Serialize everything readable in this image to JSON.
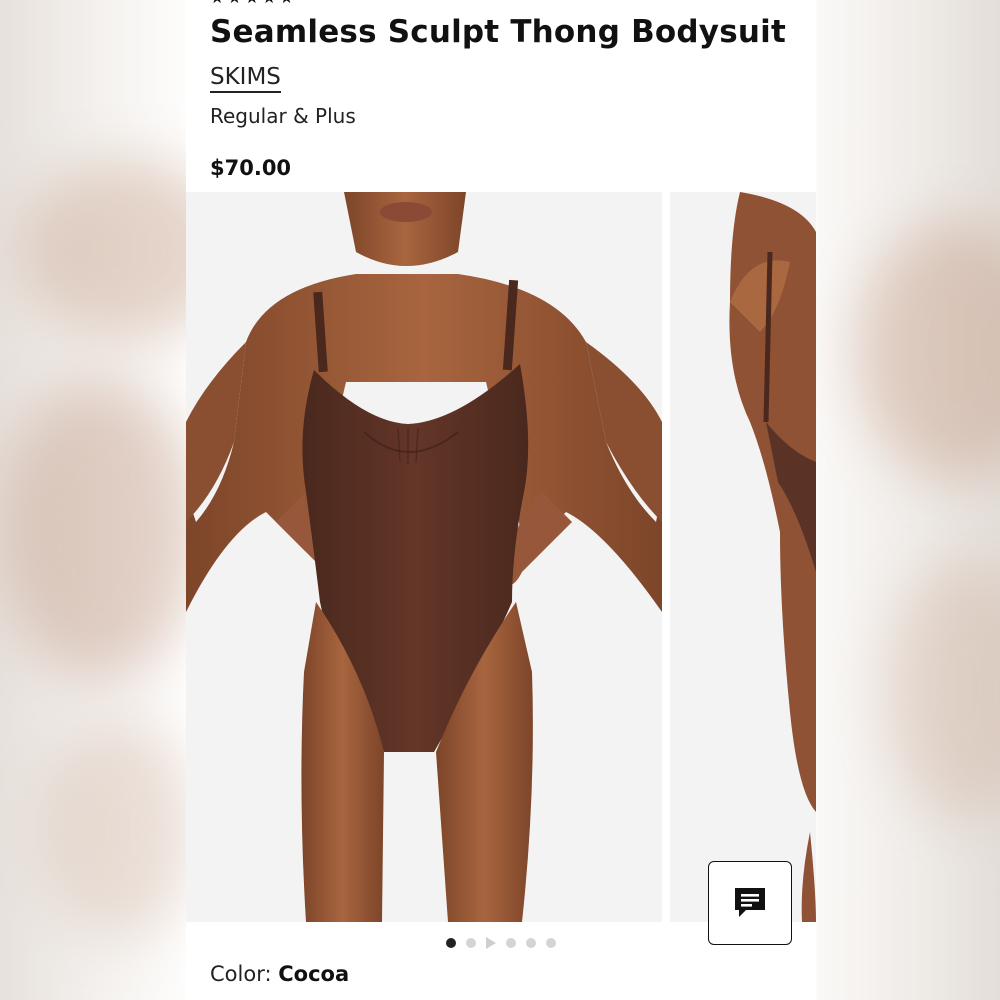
{
  "product": {
    "title": "Seamless Sculpt Thong Bodysuit",
    "brand": "SKIMS",
    "variant": "Regular & Plus",
    "price": "$70.00"
  },
  "gallery": {
    "slide_count": 6,
    "active_index": 0,
    "main_image": "model-front-cocoa-bodysuit",
    "next_image": "model-back-cocoa-bodysuit",
    "play_indicator_index": 2
  },
  "color": {
    "label": "Color:",
    "value": "Cocoa",
    "swatch_hex": "#5a3326"
  },
  "chat": {
    "icon": "chat-bubble-icon"
  },
  "colors": {
    "text": "#111111",
    "garment": "#5a3326",
    "skin": "#9a5a3a",
    "image_bg": "#f4f3f3",
    "dot_active": "#222222",
    "dot_inactive": "#d4d4d4"
  }
}
